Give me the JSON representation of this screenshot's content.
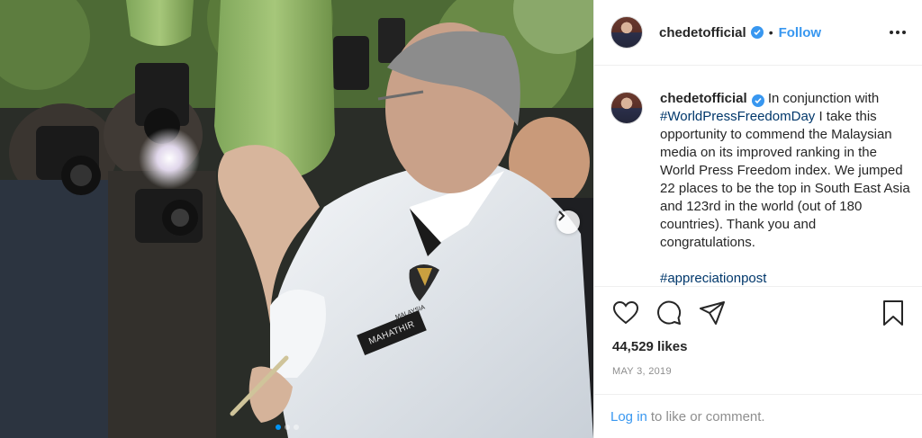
{
  "post": {
    "username": "chedetofficial",
    "separator": "•",
    "follow_label": "Follow",
    "caption": {
      "username": "chedetofficial",
      "text_1": " In conjunction with ",
      "hashtag_1": "#WorldPressFreedomDay",
      "text_2": " I take this opportunity to commend the Malaysian media on its improved ranking in the World Press Freedom index. We jumped 22 places to be the top in South East Asia and 123rd in the world (out of 180 countries). Thank you and congratulations.",
      "hashtag_2": "#appreciationpost"
    },
    "likes": "44,529 likes",
    "date": "MAY 3, 2019",
    "login_link": "Log in",
    "login_text": "to like or comment."
  },
  "photo": {
    "badge_name": "MAHATHIR",
    "carousel_pages": 3,
    "carousel_active": 0
  },
  "icons": {
    "like": "heart-icon",
    "comment": "comment-icon",
    "share": "share-icon",
    "save": "bookmark-icon",
    "more": "more-options-icon",
    "next": "chevron-right-icon",
    "verified": "verified-badge-icon"
  },
  "colors": {
    "accent": "#3897f0",
    "hashtag": "#00376b",
    "muted": "#8e8e8e",
    "carousel_dot_active": "#0095f6"
  }
}
